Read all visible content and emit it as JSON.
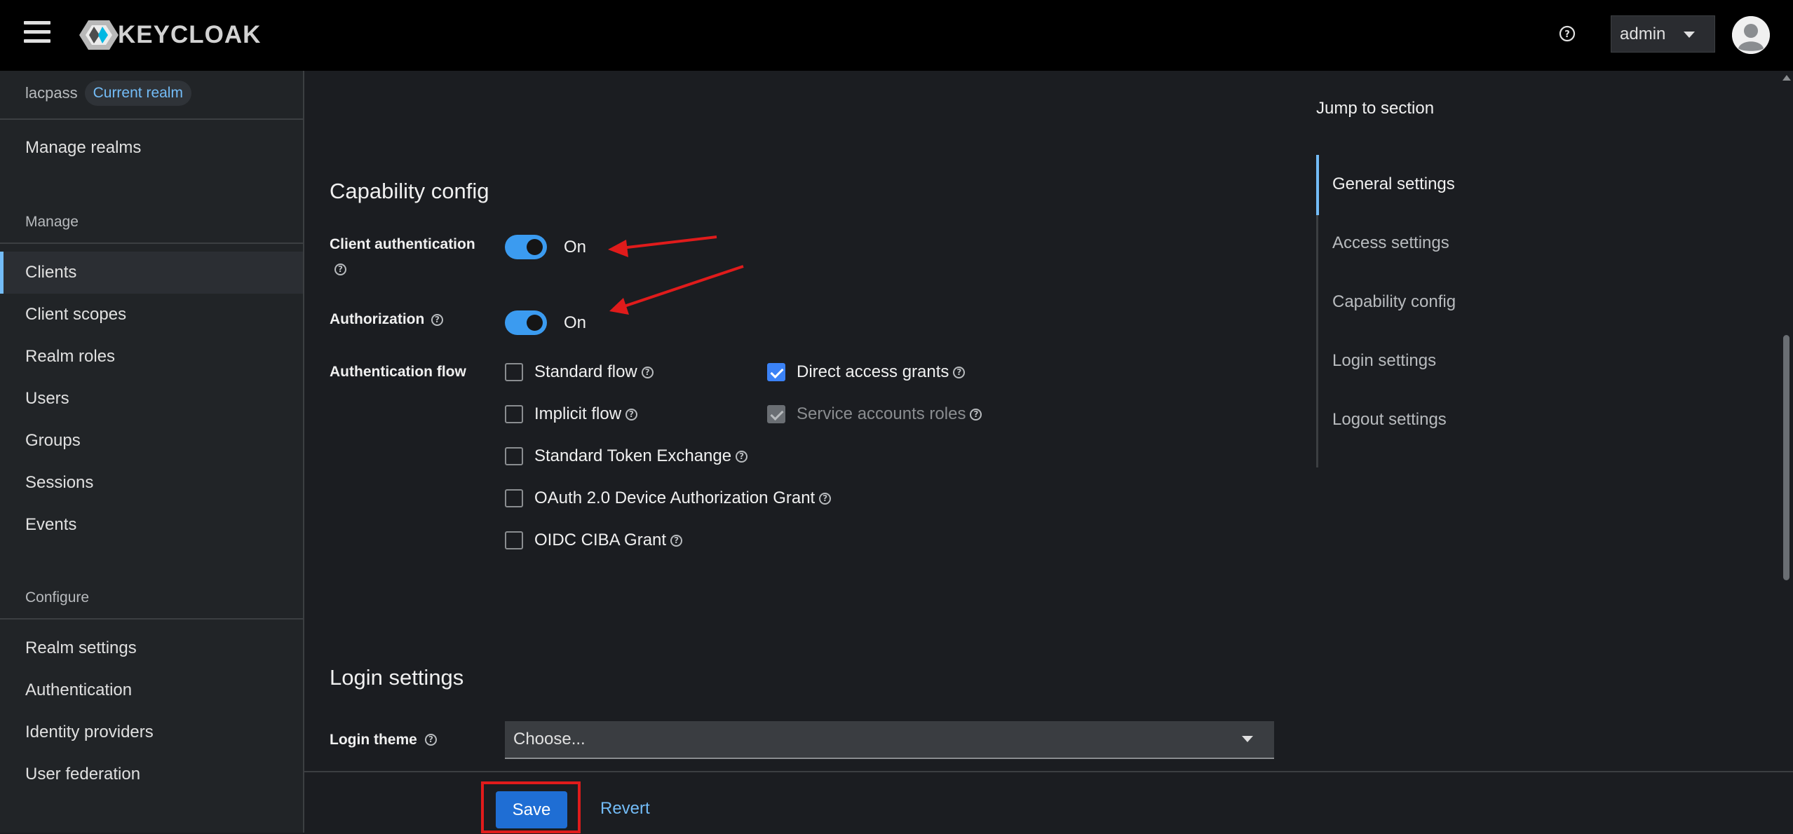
{
  "header": {
    "logo_text": "KEYCLOAK",
    "user": "admin"
  },
  "sidebar": {
    "realm_name": "lacpass",
    "realm_badge": "Current realm",
    "manage_realms": "Manage realms",
    "manage_label": "Manage",
    "manage_items": [
      {
        "label": "Clients"
      },
      {
        "label": "Client scopes"
      },
      {
        "label": "Realm roles"
      },
      {
        "label": "Users"
      },
      {
        "label": "Groups"
      },
      {
        "label": "Sessions"
      },
      {
        "label": "Events"
      }
    ],
    "configure_label": "Configure",
    "configure_items": [
      {
        "label": "Realm settings"
      },
      {
        "label": "Authentication"
      },
      {
        "label": "Identity providers"
      },
      {
        "label": "User federation"
      }
    ],
    "active_item": "Clients"
  },
  "capability": {
    "title": "Capability config",
    "client_auth_label": "Client authentication",
    "client_auth_value": "On",
    "authorization_label": "Authorization",
    "authorization_value": "On",
    "auth_flow_label": "Authentication flow",
    "flows": [
      {
        "label": "Standard flow",
        "checked": false
      },
      {
        "label": "Direct access grants",
        "checked": true
      },
      {
        "label": "Implicit flow",
        "checked": false
      },
      {
        "label": "Service accounts roles",
        "checked": true,
        "disabled": true
      },
      {
        "label": "Standard Token Exchange",
        "checked": false
      },
      {
        "label": "OAuth 2.0 Device Authorization Grant",
        "checked": false
      },
      {
        "label": "OIDC CIBA Grant",
        "checked": false
      }
    ]
  },
  "login": {
    "title": "Login settings",
    "theme_label": "Login theme",
    "theme_value": "Choose..."
  },
  "footer": {
    "save": "Save",
    "revert": "Revert"
  },
  "jump": {
    "title": "Jump to section",
    "items": [
      {
        "label": "General settings"
      },
      {
        "label": "Access settings"
      },
      {
        "label": "Capability config"
      },
      {
        "label": "Login settings"
      },
      {
        "label": "Logout settings"
      }
    ],
    "active": "General settings"
  },
  "colors": {
    "accent": "#73bcf7",
    "switch_on": "#3b9bf0",
    "primary_button": "#1f6ed4",
    "annotation_red": "#e01b1b"
  },
  "icons": [
    "hamburger-icon",
    "keycloak-logo-icon",
    "help-icon",
    "caret-down-icon",
    "avatar-icon",
    "arrow-annotation-icon"
  ]
}
